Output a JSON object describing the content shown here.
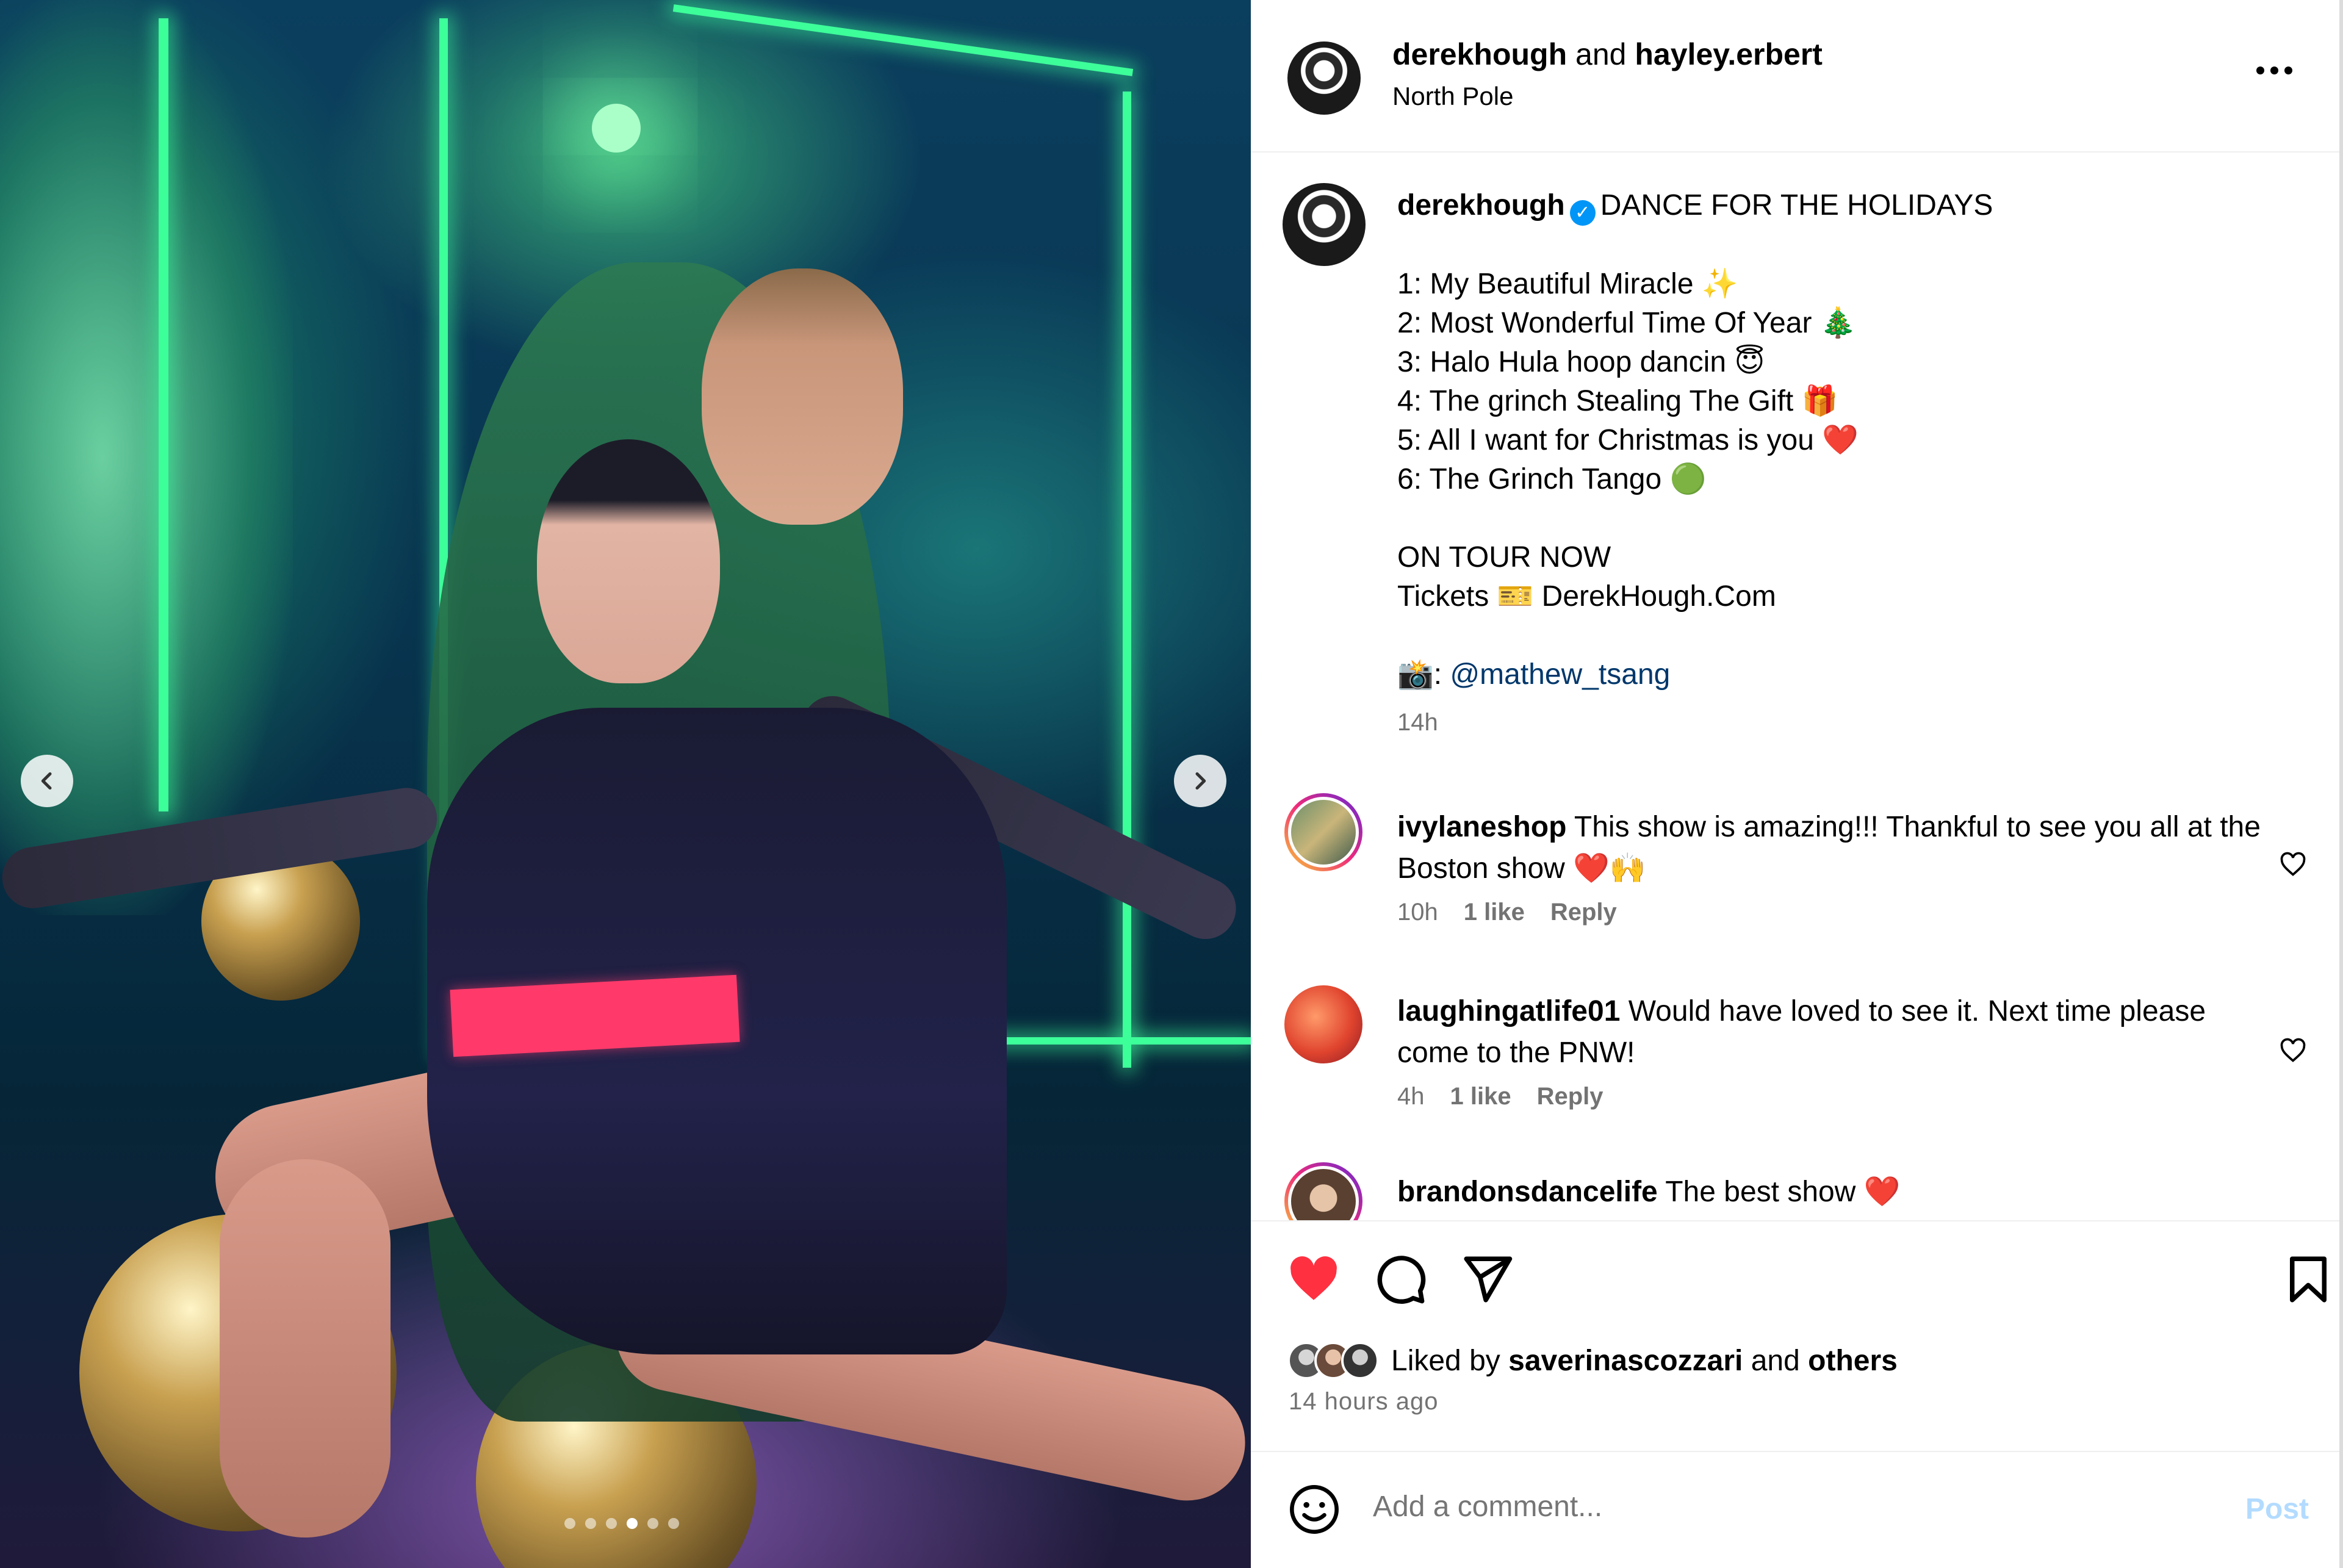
{
  "header": {
    "user1": "derekhough",
    "joiner": "and",
    "user2": "hayley.erbert",
    "location": "North Pole"
  },
  "caption": {
    "username": "derekhough",
    "verified_icon": "verified-badge-icon",
    "title": "DANCE FOR THE HOLIDAYS",
    "lines": [
      "1: My Beautiful Miracle ✨",
      "2: Most Wonderful Time Of Year 🎄",
      "3: Halo Hula hoop dancin 😇",
      "4: The grinch Stealing The Gift 🎁",
      "5: All I want for Christmas is you ❤️",
      "6: The Grinch Tango 🟢",
      "",
      "ON TOUR NOW",
      "Tickets 🎫 DerekHough.Com",
      ""
    ],
    "photo_credit_prefix": "📸: ",
    "photo_credit_mention": "@mathew_tsang",
    "time": "14h"
  },
  "comments": [
    {
      "username": "ivylaneshop",
      "text": "This show is amazing!!! Thankful to see you all at the Boston show ❤️🙌",
      "time": "10h",
      "likes": "1 like",
      "reply": "Reply"
    },
    {
      "username": "laughingatlife01",
      "text": "Would have loved to see it. Next time please come to the PNW!",
      "time": "4h",
      "likes": "1 like",
      "reply": "Reply"
    },
    {
      "username": "brandonsdancelife",
      "text": "The best show ❤️"
    }
  ],
  "actions": {
    "like_icon": "heart-filled-icon",
    "comment_icon": "comment-icon",
    "share_icon": "send-icon",
    "save_icon": "bookmark-icon",
    "like_color": "#ff3040"
  },
  "likes": {
    "prefix": "Liked by",
    "user": "saverinascozzari",
    "joiner": "and",
    "others": "others",
    "ago": "14 hours ago"
  },
  "add_comment": {
    "placeholder": "Add a comment...",
    "post_label": "Post"
  },
  "carousel": {
    "total_slides": 6,
    "active_slide": 4
  },
  "colors": {
    "link": "#00376b",
    "muted": "#737373",
    "post_disabled": "#b3dbff",
    "verified": "#0095f6"
  }
}
